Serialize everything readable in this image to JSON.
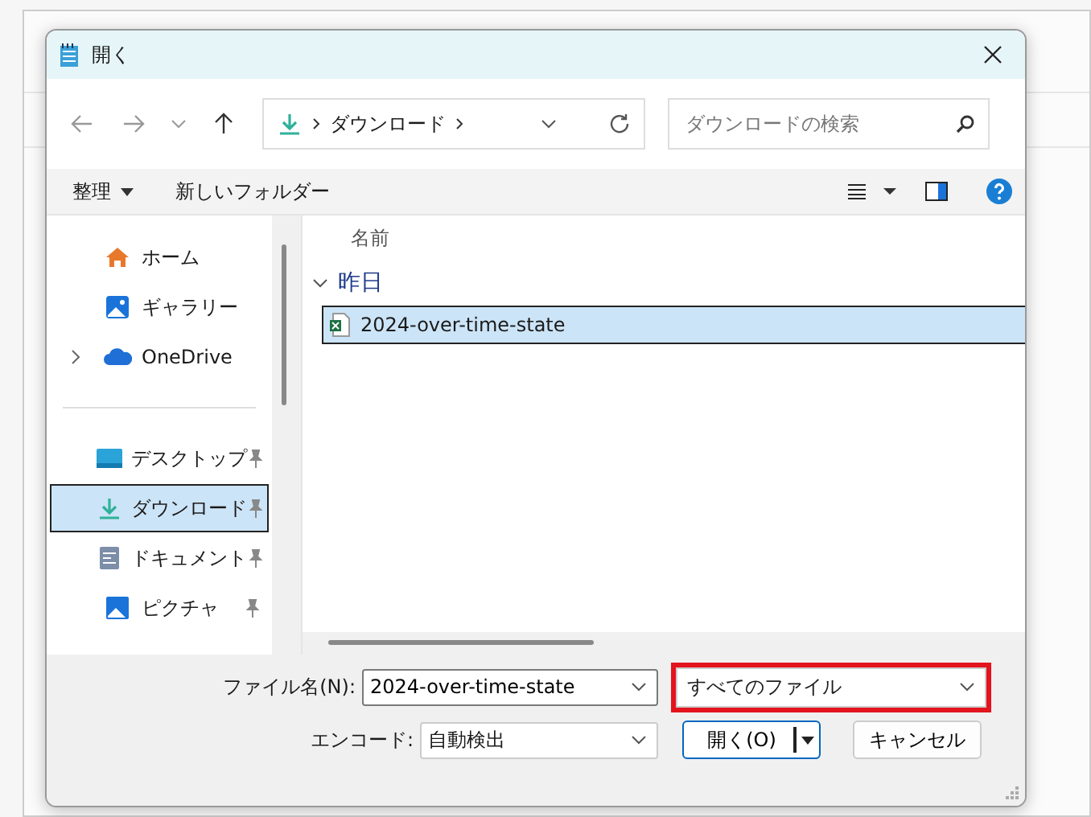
{
  "window": {
    "title": "開く"
  },
  "nav": {
    "path": [
      "ダウンロード"
    ],
    "search_placeholder": "ダウンロードの検索"
  },
  "toolbar": {
    "organize": "整理",
    "new_folder": "新しいフォルダー"
  },
  "sidebar": {
    "items": [
      {
        "kind": "home",
        "label": "ホーム",
        "pinned": false,
        "expandable": false,
        "selected": false
      },
      {
        "kind": "gallery",
        "label": "ギャラリー",
        "pinned": false,
        "expandable": false,
        "selected": false
      },
      {
        "kind": "cloud",
        "label": "OneDrive",
        "pinned": false,
        "expandable": true,
        "selected": false
      },
      {
        "kind": "separator"
      },
      {
        "kind": "desktop",
        "label": "デスクトップ",
        "pinned": true,
        "expandable": false,
        "selected": false
      },
      {
        "kind": "download",
        "label": "ダウンロード",
        "pinned": true,
        "expandable": false,
        "selected": true
      },
      {
        "kind": "document",
        "label": "ドキュメント",
        "pinned": true,
        "expandable": false,
        "selected": false
      },
      {
        "kind": "picture",
        "label": "ピクチャ",
        "pinned": true,
        "expandable": false,
        "selected": false
      }
    ]
  },
  "file_list": {
    "column": "名前",
    "groups": [
      {
        "label": "昨日",
        "expanded": true,
        "files": [
          {
            "name": "2024-over-time-state",
            "selected": true
          }
        ]
      }
    ]
  },
  "footer": {
    "filename_label": "ファイル名(N):",
    "filename": "2024-over-time-state",
    "filetype": "すべてのファイル",
    "filetype_highlighted": true,
    "encode_label": "エンコード:",
    "encode": "自動検出",
    "open_button": "開く(O)",
    "cancel_button": "キャンセル"
  }
}
